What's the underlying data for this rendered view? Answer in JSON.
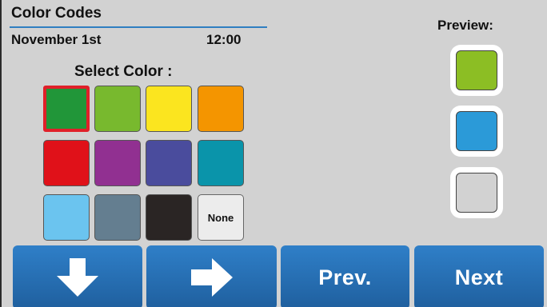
{
  "header": {
    "title": "Color Codes",
    "date": "November 1st",
    "time": "12:00"
  },
  "palette": {
    "label": "Select Color :",
    "swatches": [
      {
        "name": "dark-green",
        "color": "#219639",
        "selected": true
      },
      {
        "name": "light-green",
        "color": "#78b92e"
      },
      {
        "name": "yellow",
        "color": "#fbe51f"
      },
      {
        "name": "orange",
        "color": "#f49500"
      },
      {
        "name": "red",
        "color": "#e01119"
      },
      {
        "name": "purple",
        "color": "#913091"
      },
      {
        "name": "indigo",
        "color": "#4a4c9d"
      },
      {
        "name": "teal",
        "color": "#0a94aa"
      },
      {
        "name": "light-blue",
        "color": "#6bc4ef"
      },
      {
        "name": "slate",
        "color": "#647e90"
      },
      {
        "name": "black",
        "color": "#2a2524"
      },
      {
        "name": "none",
        "label": "None"
      }
    ]
  },
  "preview": {
    "label": "Preview:",
    "slots": [
      {
        "color": "#8cbe24"
      },
      {
        "color": "#2b9ad8"
      },
      {
        "color": "#d2d2d2"
      }
    ]
  },
  "buttons": {
    "down_icon": "arrow-down-icon",
    "right_icon": "arrow-right-icon",
    "prev_label": "Prev.",
    "next_label": "Next"
  }
}
